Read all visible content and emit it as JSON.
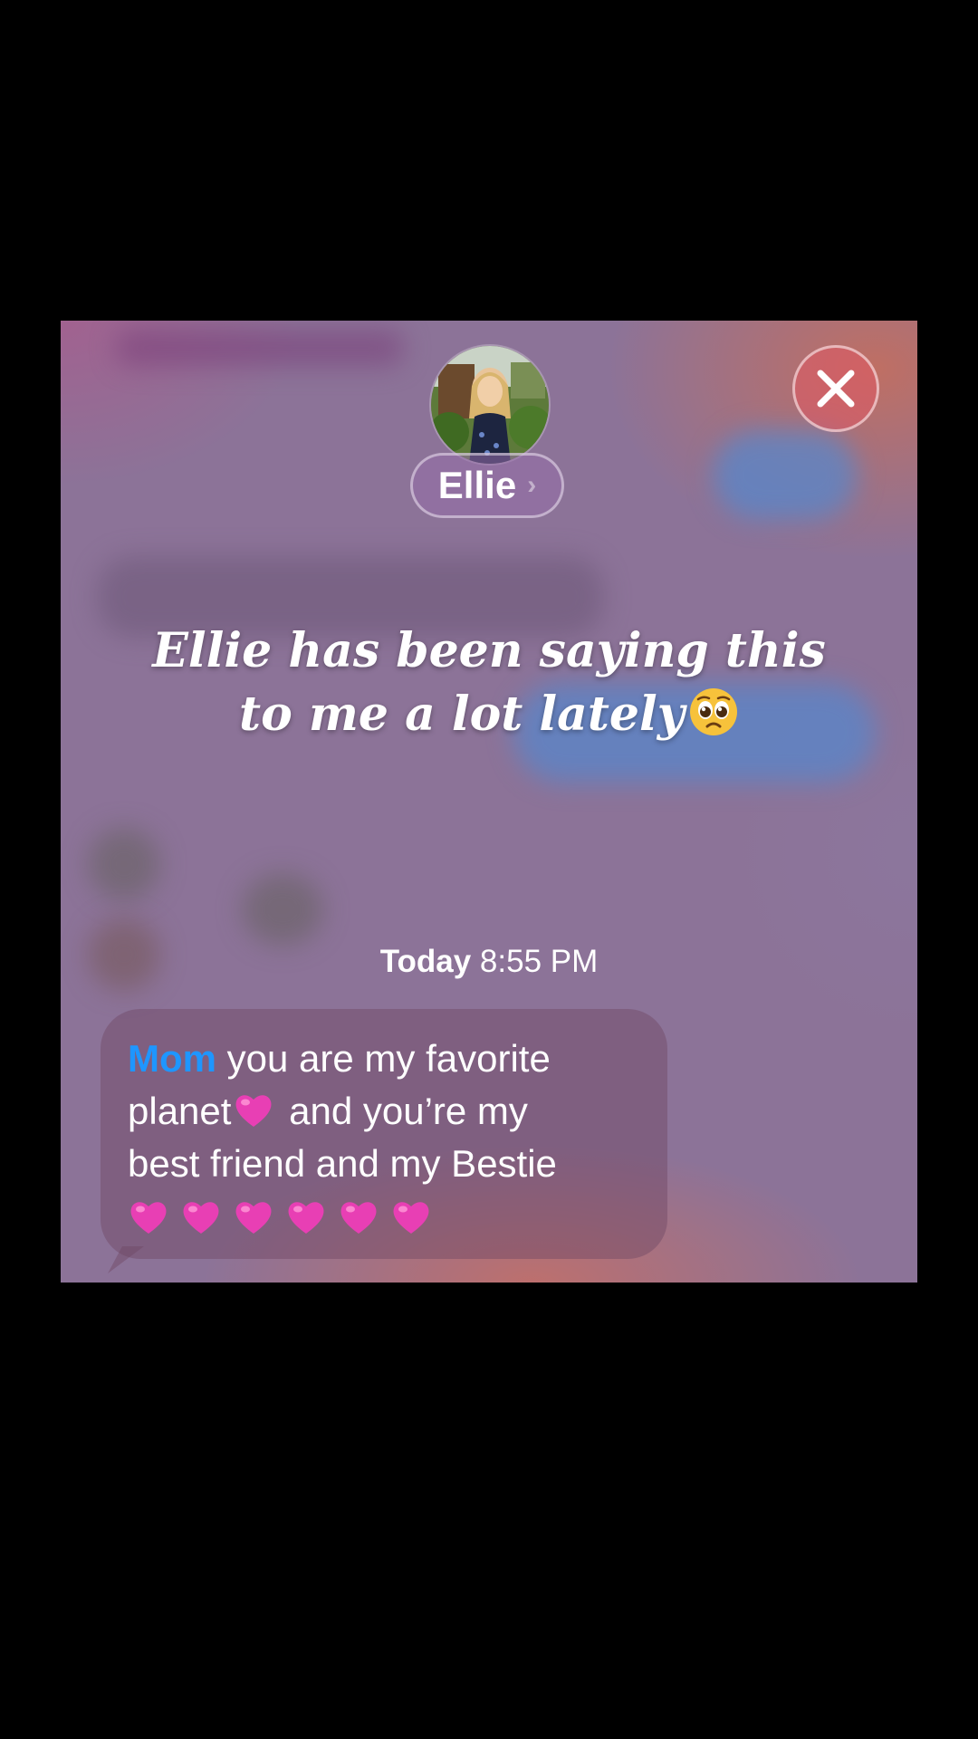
{
  "contact": {
    "name": "Ellie",
    "chevron": "›",
    "avatar_icon": "contact-photo"
  },
  "close_icon": "close-x-icon",
  "caption": {
    "line1": "Ellie has been saying this",
    "line2": "to me a lot lately",
    "emoji": "pleading-face-emoji"
  },
  "timestamp": {
    "day": "Today",
    "time": "8:55 PM"
  },
  "message": {
    "name": "Mom",
    "text1": " you are my favorite",
    "text2": "planet",
    "text3": " and you’re my",
    "text4": "best friend and my Bestie",
    "heart_icon": "pink-heart-emoji",
    "trailing_hearts": 6
  },
  "colors": {
    "mention": "#1e96ff",
    "heart": "#e83fb4",
    "close_button": "#dc5a64"
  }
}
